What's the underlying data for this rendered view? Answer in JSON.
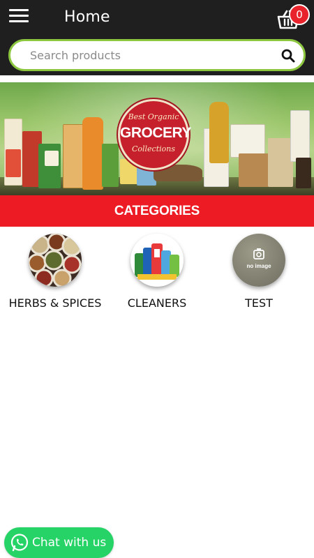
{
  "header": {
    "title": "Home",
    "menu_icon": "hamburger-menu-icon",
    "cart_icon": "shopping-basket-icon",
    "cart_count": "0"
  },
  "search": {
    "placeholder": "Search products",
    "value": "",
    "icon": "search-icon"
  },
  "banner": {
    "line1": "Best Organic",
    "line2": "GROCERY",
    "line3": "Collections"
  },
  "categories": {
    "heading": "CATEGORIES",
    "items": [
      {
        "label": "HERBS & SPICES",
        "image": "spice-jars-photo"
      },
      {
        "label": "CLEANERS",
        "image": "cleaner-bottles-photo"
      },
      {
        "label": "TEST",
        "image": "no-image-placeholder",
        "placeholder_text": "no image"
      }
    ]
  },
  "chat": {
    "label": "Chat with us",
    "icon": "whatsapp-icon"
  },
  "colors": {
    "header_bg": "#1f1f1f",
    "search_border": "#8dc63f",
    "categories_bar": "#ed1c24",
    "cart_badge": "#e8232b",
    "chat_button": "#25d366"
  }
}
